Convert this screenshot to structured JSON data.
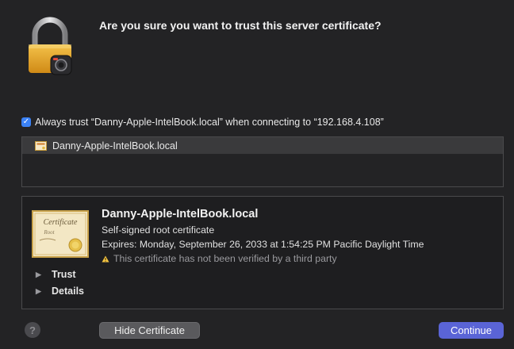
{
  "dialog": {
    "title": "Are you sure you want to trust this server certificate?",
    "always_trust": {
      "checked": true,
      "label": "Always trust “Danny-Apple-IntelBook.local” when connecting to “192.168.4.108”"
    },
    "cert_list": [
      {
        "name": "Danny-Apple-IntelBook.local",
        "selected": true
      }
    ],
    "details": {
      "name": "Danny-Apple-IntelBook.local",
      "type": "Self-signed root certificate",
      "expires": "Expires: Monday, September 26, 2033 at 1:54:25 PM Pacific Daylight Time",
      "warning": "This certificate has not been verified by a third party",
      "icon_text": {
        "title": "Certificate",
        "sub": "Root"
      },
      "sections": [
        {
          "label": "Trust",
          "expanded": false
        },
        {
          "label": "Details",
          "expanded": false
        }
      ]
    },
    "buttons": {
      "help": "?",
      "hide_certificate": "Hide Certificate",
      "continue": "Continue"
    },
    "icons": {
      "lock": "lock-icon",
      "certificate": "certificate-icon",
      "warning": "warning-icon"
    },
    "colors": {
      "accent": "#5a64d6",
      "checkbox": "#3b82f6",
      "warning": "#f5c542"
    }
  }
}
